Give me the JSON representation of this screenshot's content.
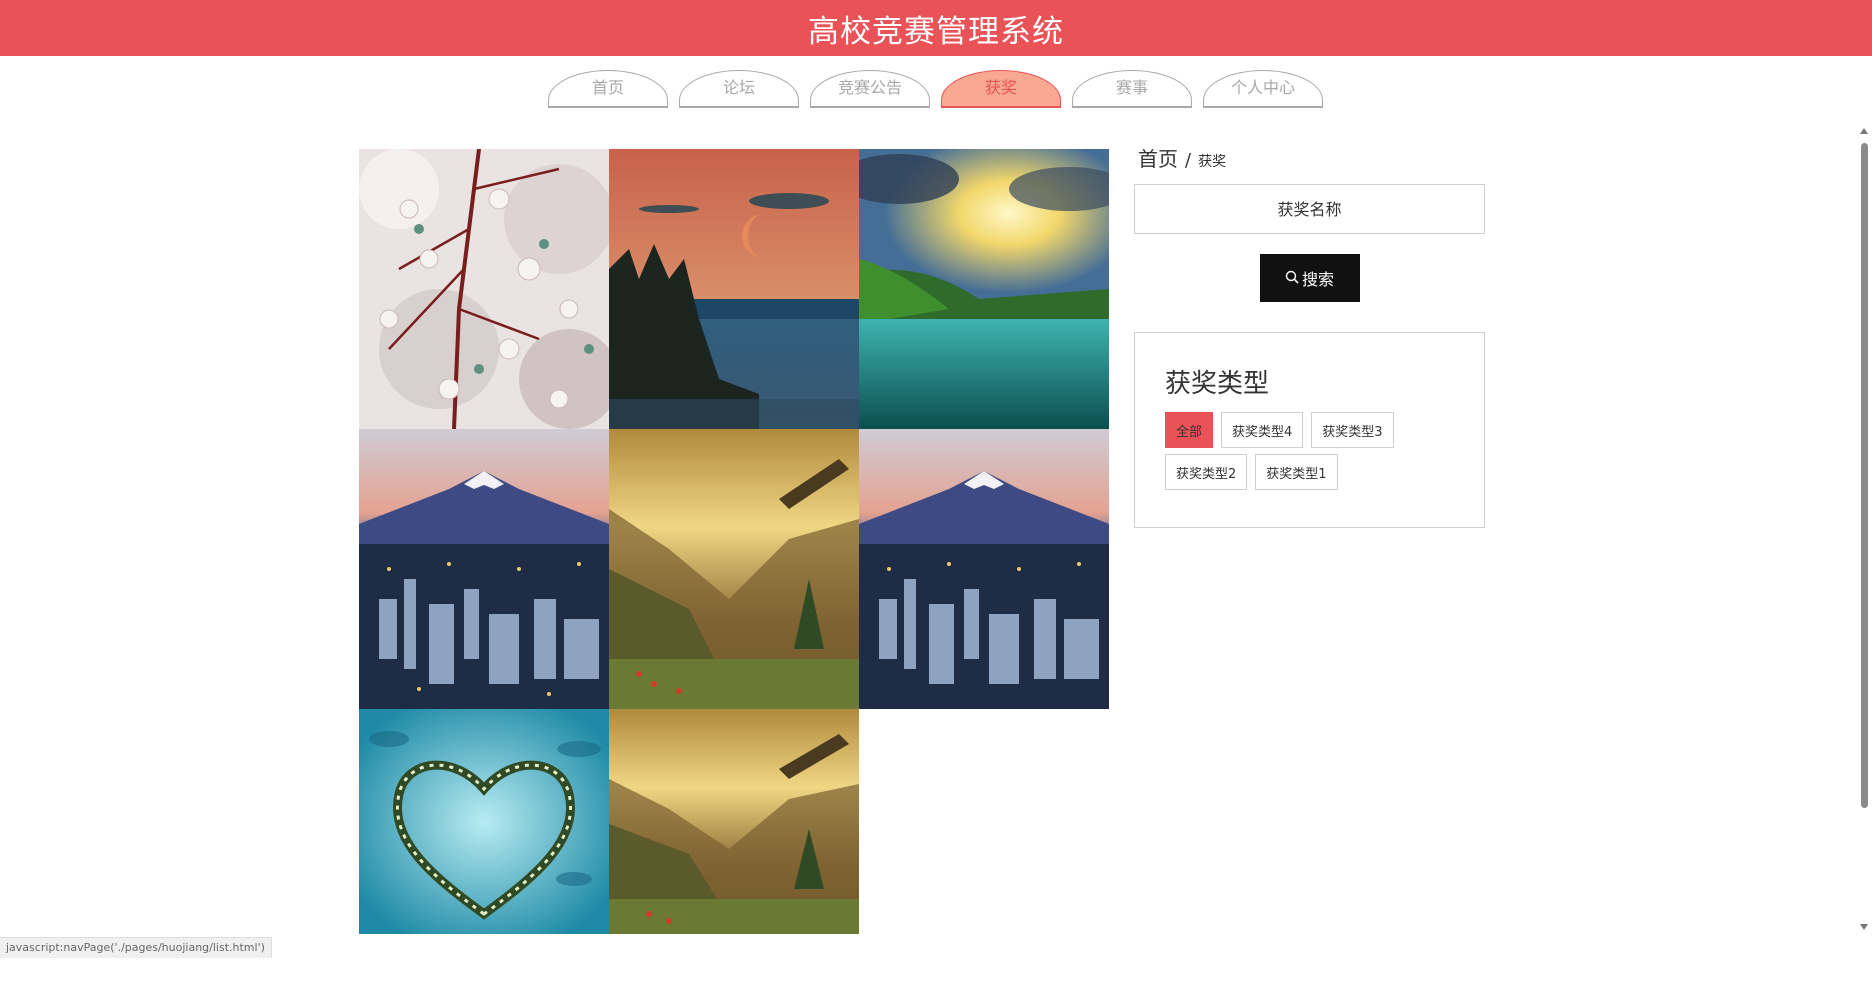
{
  "header": {
    "title": "高校竞赛管理系统"
  },
  "nav": {
    "tabs": [
      {
        "label": "首页",
        "active": false
      },
      {
        "label": "论坛",
        "active": false
      },
      {
        "label": "竞赛公告",
        "active": false
      },
      {
        "label": "获奖",
        "active": true
      },
      {
        "label": "赛事",
        "active": false
      },
      {
        "label": "个人中心",
        "active": false
      }
    ]
  },
  "breadcrumb": {
    "home": "首页",
    "separator": "/",
    "current": "获奖"
  },
  "search": {
    "placeholder": "获奖名称",
    "button_label": "搜索",
    "icon": "search-icon"
  },
  "types": {
    "title": "获奖类型",
    "tags": [
      {
        "label": "全部",
        "active": true
      },
      {
        "label": "获奖类型4",
        "active": false
      },
      {
        "label": "获奖类型3",
        "active": false
      },
      {
        "label": "获奖类型2",
        "active": false
      },
      {
        "label": "获奖类型1",
        "active": false
      }
    ]
  },
  "gallery": {
    "images": [
      {
        "scene": "cherry-blossom"
      },
      {
        "scene": "moon-lake"
      },
      {
        "scene": "sunset-lake"
      },
      {
        "scene": "fuji-city"
      },
      {
        "scene": "mountain-valley"
      },
      {
        "scene": "fuji-city"
      },
      {
        "scene": "heart-island"
      },
      {
        "scene": "mountain-valley"
      }
    ]
  },
  "colors": {
    "brand": "#e95257",
    "active_tab_bg": "#f9a892",
    "button_dark": "#111111"
  },
  "status_bar": {
    "text": "javascript:navPage('./pages/huojiang/list.html')"
  }
}
